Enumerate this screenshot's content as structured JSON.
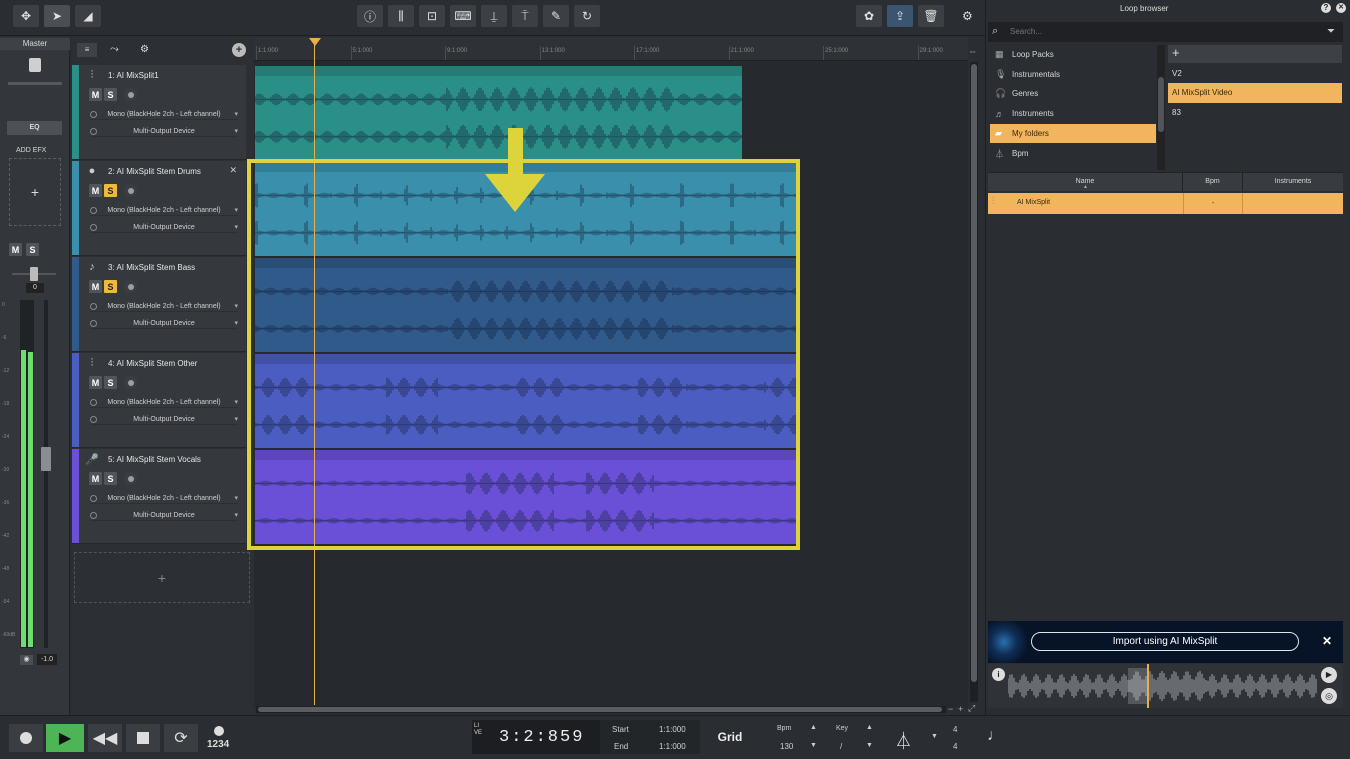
{
  "toolbar": {
    "left_icons": [
      "move-icon",
      "pointer-icon",
      "volume-ramp-icon"
    ],
    "center_icons": [
      "info-icon",
      "mixer-icon",
      "fx-icon",
      "keyboard-icon",
      "split-icon",
      "stem-icon",
      "pen-icon",
      "loop-icon"
    ],
    "right_icons": [
      "settings-gear-icon",
      "share-icon",
      "trash-icon",
      "preferences-icon"
    ]
  },
  "master": {
    "label": "Master",
    "eq_label": "EQ",
    "add_efx_label": "ADD EFX",
    "plus": "+",
    "m": "M",
    "s": "S",
    "volume_value": "0",
    "meter_value": "-1.0",
    "meter_level": 0.78,
    "scale": [
      "0",
      "-6",
      "-12",
      "-18",
      "-24",
      "-30",
      "-36",
      "-42",
      "-48",
      "-54",
      "-60dB"
    ]
  },
  "timeline": {
    "markers": [
      "1:1:000",
      "5:1:000",
      "9:1:000",
      "13:1:000",
      "17:1:000",
      "21:1:000",
      "25:1:000",
      "29:1:000"
    ]
  },
  "tracks": [
    {
      "name": "1: AI MixSplit1",
      "icon": "waveform-icon",
      "m": "M",
      "s": "S",
      "solo": false,
      "input": "Mono (BlackHole 2ch - Left channel)",
      "output": "Multi-Output Device",
      "color": "#2a8f86"
    },
    {
      "name": "2: AI MixSplit Stem Drums",
      "icon": "drum-icon",
      "m": "M",
      "s": "S",
      "solo": true,
      "input": "Mono (BlackHole 2ch - Left channel)",
      "output": "Multi-Output Device",
      "color": "#3a90ac"
    },
    {
      "name": "3: AI MixSplit Stem Bass",
      "icon": "guitar-icon",
      "m": "M",
      "s": "S",
      "solo": true,
      "input": "Mono (BlackHole 2ch - Left channel)",
      "output": "Multi-Output Device",
      "color": "#2f5a8a"
    },
    {
      "name": "4: AI MixSplit Stem Other",
      "icon": "waveform-icon",
      "m": "M",
      "s": "S",
      "solo": false,
      "input": "Mono (BlackHole 2ch - Left channel)",
      "output": "Multi-Output Device",
      "color": "#4b5dc0"
    },
    {
      "name": "5: AI MixSplit Stem Vocals",
      "icon": "microphone-icon",
      "m": "M",
      "s": "S",
      "solo": false,
      "input": "Mono (BlackHole 2ch - Left channel)",
      "output": "Multi-Output Device",
      "color": "#6a50d6"
    }
  ],
  "add_track": "+",
  "loop_browser": {
    "title": "Loop browser",
    "search_placeholder": "Search...",
    "categories": [
      {
        "label": "Loop Packs",
        "icon": "grid-icon"
      },
      {
        "label": "Instrumentals",
        "icon": "microphone-icon"
      },
      {
        "label": "Genres",
        "icon": "headphones-icon"
      },
      {
        "label": "Instruments",
        "icon": "guitar-icon"
      },
      {
        "label": "My folders",
        "icon": "folder-icon",
        "selected": true
      },
      {
        "label": "Bpm",
        "icon": "metronome-icon"
      }
    ],
    "add": "+",
    "folders": [
      {
        "label": "V2",
        "selected": false
      },
      {
        "label": "AI MixSplit Video",
        "selected": true
      },
      {
        "label": "83",
        "selected": false
      }
    ],
    "columns": [
      "Name",
      "Bpm",
      "Instruments"
    ],
    "rows": [
      {
        "name": "AI MixSplit",
        "bpm": "-",
        "instruments": ""
      }
    ],
    "import_label": "Import using AI MixSplit",
    "close": "✕"
  },
  "transport": {
    "time": "3:2:859",
    "live": "LIVE",
    "start_label": "Start",
    "end_label": "End",
    "start_value": "1:1:000",
    "end_value": "1:1:000",
    "grid_label": "Grid",
    "bpm_label": "Bpm",
    "bpm_value": "130",
    "key_label": "Key",
    "key_value": "/",
    "sig_top": "4",
    "sig_bottom": "4",
    "countin_label": "1234"
  }
}
